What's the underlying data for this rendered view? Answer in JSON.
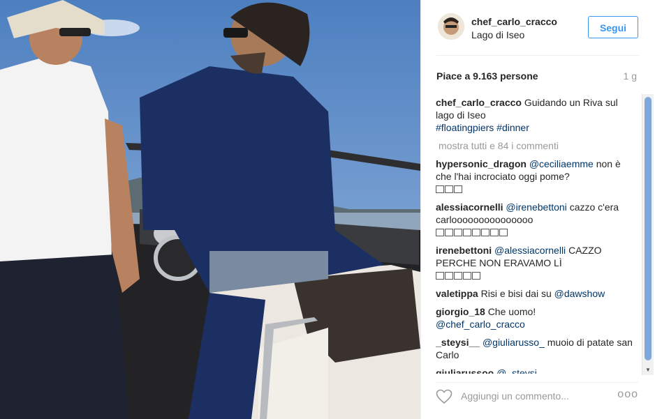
{
  "post": {
    "username": "chef_carlo_cracco",
    "location": "Lago di Iseo",
    "follow_label": "Segui",
    "likes": "Piace a 9.163 persone",
    "time_ago": "1 g"
  },
  "caption": {
    "user": "chef_carlo_cracco",
    "text": "Guidando un Riva sul lago di Iseo",
    "hashtags": "#floatingpiers #dinner"
  },
  "show_all": "mostra tutti e 84 i commenti",
  "comments": [
    {
      "user": "hypersonic_dragon",
      "mention": "@ceciliaemme",
      "text": "non è che l'hai incrociato oggi pome?"
    },
    {
      "user": "alessiacornelli",
      "mention": "@irenebettoni",
      "text": "cazzo c'era carlooooooooooooooo"
    },
    {
      "user": "irenebettoni",
      "mention": "@alessiacornelli",
      "text": "CAZZO PERCHE NON ERAVAMO LÌ"
    },
    {
      "user": "valetippa",
      "text": "Risi e bisi dai su",
      "mention": "@dawshow"
    },
    {
      "user": "giorgio_18",
      "text": "Che uomo!",
      "mention": "@chef_carlo_cracco"
    },
    {
      "user": "_steysi__",
      "mention": "@giuliarusso_",
      "text": "muoio di patate san Carlo"
    },
    {
      "user": "giuliarussoo",
      "mention": "@_steysi"
    }
  ],
  "footer": {
    "add_comment_placeholder": "Aggiungi un commento...",
    "more_options": "ooo"
  }
}
